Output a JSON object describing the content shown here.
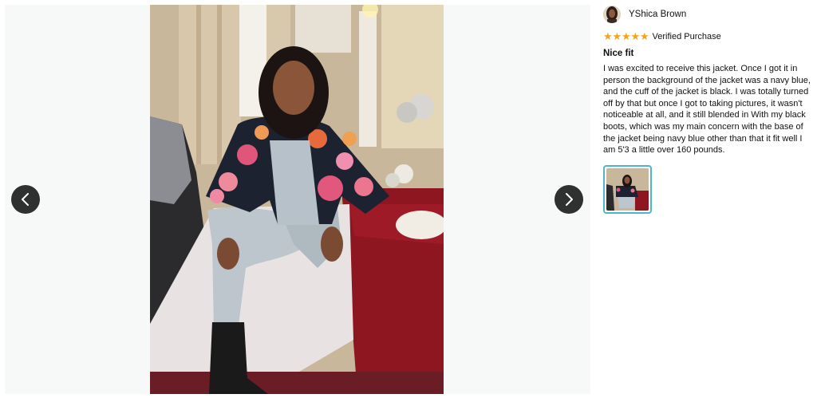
{
  "viewer": {
    "prev_label": "Previous image",
    "next_label": "Next image"
  },
  "review": {
    "reviewer_name": "YShica Brown",
    "rating": 5,
    "rating_max": 5,
    "verified_label": "Verified Purchase",
    "title": "Nice fit",
    "body": "I was excited to receive this jacket. Once I got it in person the background of the jacket was a navy blue, and the cuff of the jacket is black. I was totally turned off by that but once I got to taking pictures, it wasn't noticeable at all, and it still blended in With my black boots, which was my main concern with the base of the jacket being navy blue other than that it fit well I am 5'3 a little over 160 pounds."
  },
  "thumbnails": [
    {
      "selected": true
    }
  ],
  "colors": {
    "star": "#f7a21b",
    "nav_button": "#2f3030",
    "thumb_border_selected": "#4fb6c9",
    "viewer_background": "#f7f8f8"
  },
  "icons": {
    "prev": "chevron-left-icon",
    "next": "chevron-right-icon",
    "star": "star-icon"
  }
}
